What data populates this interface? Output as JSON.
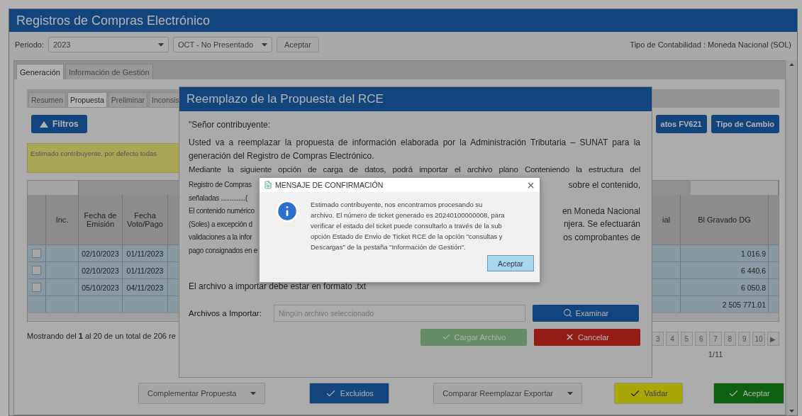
{
  "window": {
    "title": "Registros de Compras Electrónico"
  },
  "toolbar": {
    "period_label": "Periodo:",
    "year": "2023",
    "month": "OCT - No Presentado",
    "accept": "Aceptar",
    "accounting_type": "Tipo de Contabilidad : Moneda Nacional (SOL)"
  },
  "tabs": [
    {
      "label": "Generación",
      "selected": true
    },
    {
      "label": "Información de Gestión",
      "selected": false
    }
  ],
  "subtabs": [
    {
      "label": "Resumen",
      "selected": false
    },
    {
      "label": "Propuesta",
      "selected": true
    },
    {
      "label": "Preliminar",
      "selected": false
    },
    {
      "label": "Inconsis",
      "selected": false
    }
  ],
  "filters_button": "Filtros",
  "right_buttons": [
    "atos FV621",
    "Tipo de Cambio"
  ],
  "notice": "Estimado contribuyente, por defecto todas",
  "table_left": {
    "columns": [
      "Inc.",
      "Fecha de Emisión",
      "Fecha Voto/Pago"
    ],
    "rows": [
      {
        "kind": "data",
        "checked": false,
        "emission": "02/10/2023",
        "due": "01/11/2023"
      },
      {
        "kind": "data",
        "checked": false,
        "emission": "02/10/2023",
        "due": "01/11/2023"
      },
      {
        "kind": "data",
        "checked": false,
        "emission": "05/10/2023",
        "due": "04/11/2023"
      },
      {
        "kind": "total"
      }
    ]
  },
  "table_right": {
    "columns": [
      "ial",
      "Bl Gravado DG"
    ],
    "values": [
      "1 016.9",
      "6 440.6",
      "6 050.8",
      "2 505 771.01"
    ]
  },
  "showing": "Mostrando del **1** al 20 de un total de 206 re",
  "pagination": {
    "pages": [
      "3",
      "4",
      "5",
      "6",
      "7",
      "8",
      "9",
      "10"
    ],
    "next": "▶",
    "info": "1/11"
  },
  "bottom_buttons": [
    {
      "label": "Complementar Propuesta",
      "kind": "dropdown"
    },
    {
      "label": "Excluidos",
      "kind": "primary"
    },
    {
      "label": "Comparar Reemplazar Exportar",
      "kind": "dropdown"
    },
    {
      "label": "Validar",
      "kind": "warning"
    },
    {
      "label": "Aceptar",
      "kind": "success"
    }
  ],
  "rce_modal": {
    "title": "Reemplazo de la Propuesta del RCE",
    "salutation": "\"Señor contribuyente:",
    "intro": "Usted va a reemplazar la propuesta de información elaborada por la Administración Tributaria – SUNAT para la generación del Registro de Compras Electrónico.",
    "lines": [
      {
        "kind": "full",
        "left": "Mediante la siguiente opción de carga de datos, podrá importar el archivo plano Conteniendo la estructura del"
      },
      {
        "kind": "split",
        "left": "Registro de Compras",
        "right": "sobre el contenido,"
      },
      {
        "kind": "split",
        "left": "señaladas ..............("
      },
      {
        "kind": "split",
        "left": "El contenido numérico",
        "right": "en Moneda Nacional"
      },
      {
        "kind": "split",
        "left": "(Soles) a excepción d",
        "right": "njera. Se efectuarán"
      },
      {
        "kind": "split",
        "left": "validaciones a la infor",
        "right": "os comprobantes de"
      },
      {
        "kind": "split",
        "left": "pago consignados en e"
      }
    ],
    "format_note": "El archivo a importar debe estar en formato .txt",
    "file_label": "Archivos a Importar:",
    "file_placeholder": "Ningún archivo seleccionado",
    "browse": "Examinar",
    "load": {
      "label": "Cargar Archivo",
      "disabled": true
    },
    "cancel": "Cancelar"
  },
  "confirm": {
    "title": "MENSAJE DE CONFIRMACIÓN",
    "message": "Estimado contribuyente, nos encontramos procesando su archivo. El número de ticket generado es 20240100000008, para verificar el estado del ticket puede consultarlo a través de la sub opción Estado de Envio de Ticket RCE de la opción \"consultas y Descargas\" de la pestaña \"Información de Gestión\".",
    "button": "Aceptar"
  }
}
